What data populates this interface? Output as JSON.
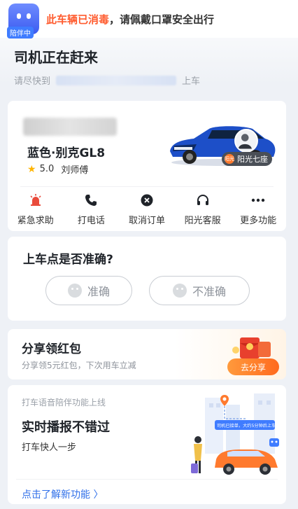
{
  "banner": {
    "badge": "陪伴中",
    "highlight": "此车辆已消毒",
    "rest": "，请佩戴口罩安全出行"
  },
  "status": {
    "title": "司机正在赶来",
    "sub_prefix": "请尽快到",
    "sub_suffix": "上车"
  },
  "driver": {
    "car_model": "蓝色·别克GL8",
    "rating": "5.0",
    "name": "刘师傅",
    "seat_tag": "阳光七座",
    "seat_logo": "阳光"
  },
  "actions": [
    {
      "label": "紧急求助",
      "icon": "alarm-icon",
      "color": "#e94b3c"
    },
    {
      "label": "打电话",
      "icon": "phone-icon",
      "color": "#1f2329"
    },
    {
      "label": "取消订单",
      "icon": "cancel-icon",
      "color": "#1f2329"
    },
    {
      "label": "阳光客服",
      "icon": "headset-icon",
      "color": "#1f2329"
    },
    {
      "label": "更多功能",
      "icon": "more-icon",
      "color": "#1f2329"
    }
  ],
  "confirm": {
    "title": "上车点是否准确?",
    "yes": "准确",
    "no": "不准确"
  },
  "share": {
    "title": "分享领红包",
    "sub": "分享领5元红包，下次用车立减",
    "button": "去分享"
  },
  "promo": {
    "label": "打车语音陪伴功能上线",
    "title": "实时播报不错过",
    "sub": "打车快人一步",
    "bubble": "司机已接单，大约5分钟后上车点",
    "link": "点击了解新功能 〉"
  },
  "colors": {
    "accent_orange": "#ff5b2e",
    "link_blue": "#2f6fe9",
    "star": "#ffb400"
  }
}
